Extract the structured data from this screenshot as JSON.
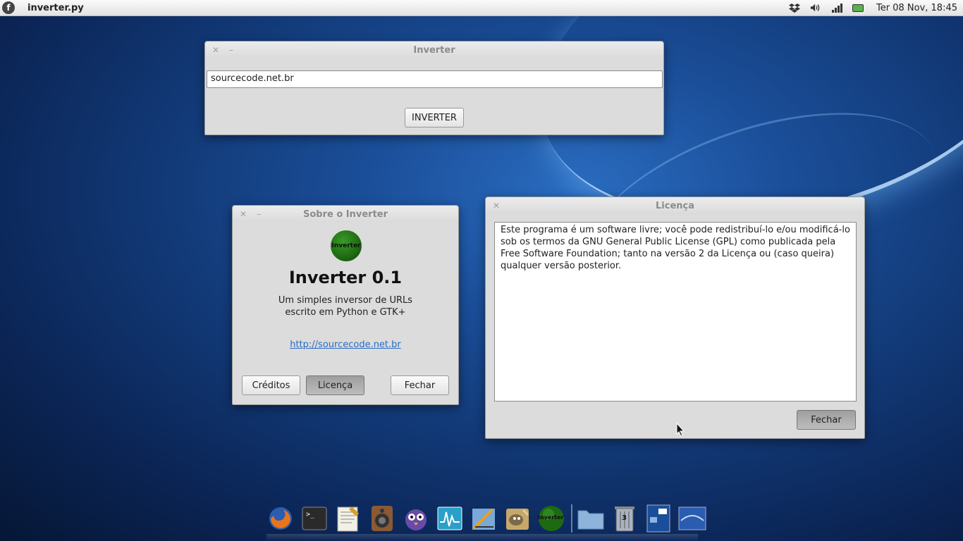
{
  "top_panel": {
    "active_app": "inverter.py",
    "clock": "Ter 08 Nov, 18:45",
    "tray_icons": [
      "dropbox-icon",
      "volume-icon",
      "network-signal-icon",
      "battery-icon"
    ]
  },
  "main_window": {
    "title": "Inverter",
    "url_value": "sourcecode.net.br",
    "invert_button": "INVERTER"
  },
  "about_dialog": {
    "title": "Sobre o Inverter",
    "logo_text": "Inverter",
    "program_name": "Inverter 0.1",
    "description_line1": "Um simples inversor de URLs",
    "description_line2": "escrito em Python e GTK+",
    "website": "http://sourcecode.net.br",
    "credits_button": "Créditos",
    "license_button": "Licença",
    "close_button": "Fechar"
  },
  "license_dialog": {
    "title": "Licença",
    "license_lines": [
      "Este programa é um software livre; você pode redistribuí-lo e/ou modificá-lo",
      "sob os termos da GNU General Public License (GPL) como publicada pela",
      "Free Software Foundation; tanto na versão 2 da Licença ou (caso queira)",
      "qualquer versão posterior."
    ],
    "close_button": "Fechar"
  },
  "dock": {
    "items": [
      {
        "name": "firefox-icon",
        "color": "#e8741c"
      },
      {
        "name": "terminal-icon",
        "color": "#2a2a2a"
      },
      {
        "name": "text-editor-icon",
        "color": "#f3f1e6"
      },
      {
        "name": "speaker-icon",
        "color": "#8a5a34"
      },
      {
        "name": "pidgin-icon",
        "color": "#6a4aa8"
      },
      {
        "name": "system-monitor-icon",
        "color": "#2aa0c8"
      },
      {
        "name": "drawing-icon",
        "color": "#7aa8d8"
      },
      {
        "name": "gimp-icon",
        "color": "#c8a86a"
      },
      {
        "name": "inverter-icon",
        "color": "#1e6a12"
      },
      {
        "name": "folder-icon",
        "color": "#8fb4dc"
      },
      {
        "name": "trash-icon",
        "color": "#aab4c2"
      },
      {
        "name": "workspaces-icon",
        "color": "#1a4e9a"
      },
      {
        "name": "desktop-icon",
        "color": "#2a5cb2"
      }
    ],
    "trash_count": "3",
    "inverter_label": "Inverter"
  }
}
